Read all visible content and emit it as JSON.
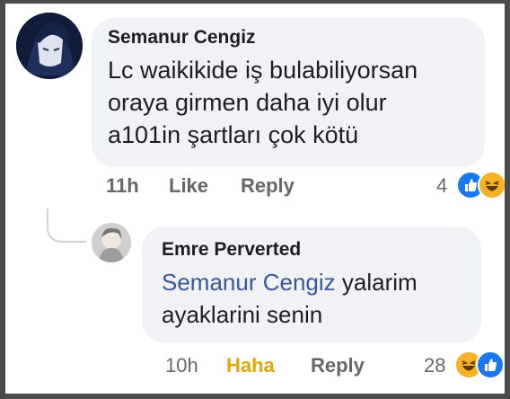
{
  "comment1": {
    "author": "Semanur Cengiz",
    "lines": [
      "Lc waikikide iş bulabiliyorsan",
      "oraya girmen daha iyi olur",
      "a101in şartları çok kötü"
    ],
    "time": "11h",
    "like_label": "Like",
    "reply_label": "Reply",
    "reaction_count": "4",
    "reactions": [
      "like-icon",
      "haha-icon"
    ],
    "colors": {
      "like": "#1877f2",
      "haha": "#f7b125"
    }
  },
  "comment2": {
    "author": "Emre Perverted",
    "mention": "Semanur Cengiz",
    "text_after_mention": " yalarim",
    "line2": "ayaklarini senin",
    "time": "10h",
    "reaction_label": "Haha",
    "reply_label": "Reply",
    "reaction_count": "28",
    "reactions": [
      "haha-icon",
      "like-icon"
    ],
    "colors": {
      "mention": "#385898",
      "haha_label": "#e0a800"
    }
  }
}
